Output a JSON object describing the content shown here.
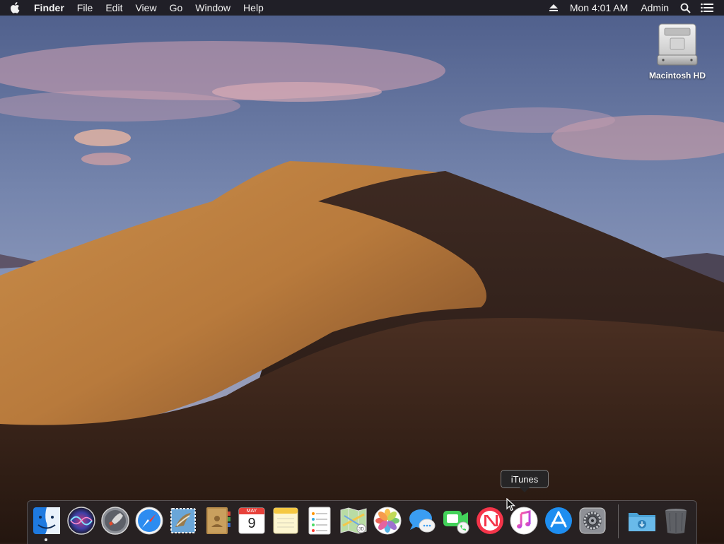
{
  "menubar": {
    "app_name": "Finder",
    "menus": [
      "File",
      "Edit",
      "View",
      "Go",
      "Window",
      "Help"
    ],
    "clock": "Mon 4:01 AM",
    "user": "Admin"
  },
  "desktop": {
    "icons": [
      {
        "label": "Macintosh HD",
        "icon": "hard-drive-icon"
      }
    ]
  },
  "tooltip": {
    "text": "iTunes"
  },
  "dock": {
    "items": [
      {
        "name": "Finder",
        "icon": "finder-icon",
        "running": true
      },
      {
        "name": "Siri",
        "icon": "siri-icon"
      },
      {
        "name": "Launchpad",
        "icon": "launchpad-icon"
      },
      {
        "name": "Safari",
        "icon": "safari-icon"
      },
      {
        "name": "Mail",
        "icon": "mail-icon"
      },
      {
        "name": "Contacts",
        "icon": "contacts-icon"
      },
      {
        "name": "Calendar",
        "icon": "calendar-icon",
        "month": "MAY",
        "day": "9"
      },
      {
        "name": "Notes",
        "icon": "notes-icon"
      },
      {
        "name": "Reminders",
        "icon": "reminders-icon"
      },
      {
        "name": "Maps",
        "icon": "maps-icon"
      },
      {
        "name": "Photos",
        "icon": "photos-icon"
      },
      {
        "name": "Messages",
        "icon": "messages-icon"
      },
      {
        "name": "FaceTime",
        "icon": "facetime-icon"
      },
      {
        "name": "News",
        "icon": "news-icon"
      },
      {
        "name": "iTunes",
        "icon": "itunes-icon"
      },
      {
        "name": "App Store",
        "icon": "app-store-icon"
      },
      {
        "name": "System Preferences",
        "icon": "system-preferences-icon"
      },
      {
        "name": "Downloads",
        "icon": "downloads-folder-icon"
      },
      {
        "name": "Trash",
        "icon": "trash-icon"
      }
    ]
  }
}
